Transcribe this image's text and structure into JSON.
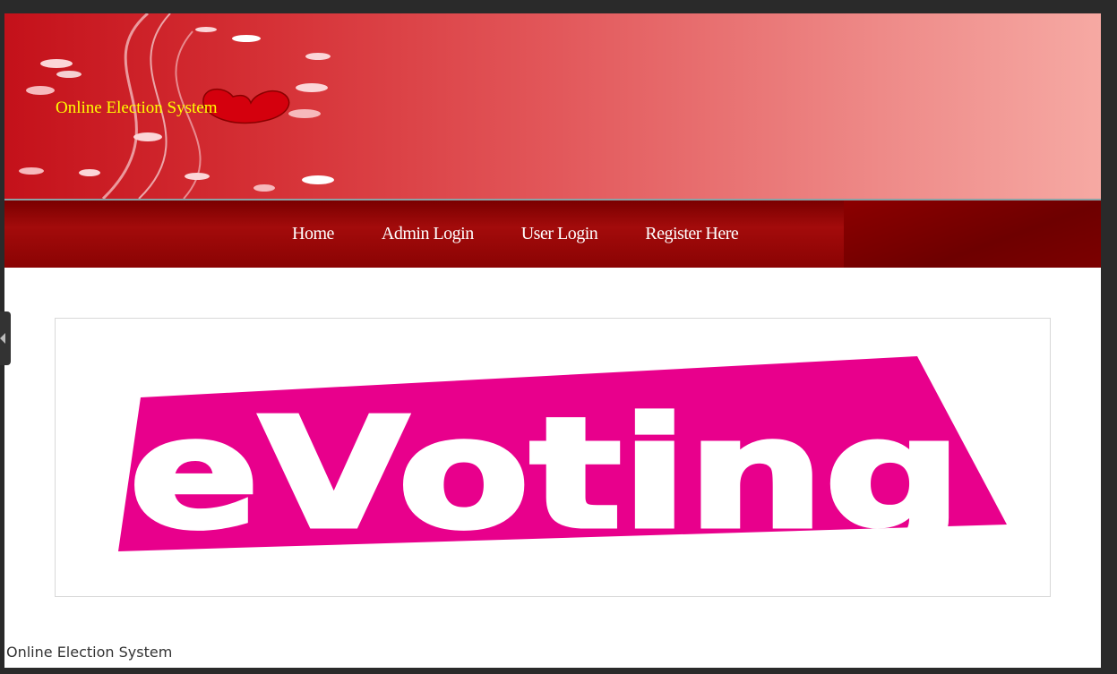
{
  "header": {
    "site_title": "Online Election System"
  },
  "nav": {
    "items": [
      {
        "label": "Home"
      },
      {
        "label": "Admin Login"
      },
      {
        "label": "User Login"
      },
      {
        "label": "Register Here"
      }
    ]
  },
  "banner": {
    "logo_text": "eVoting",
    "logo_color": "#e8008c"
  },
  "footer": {
    "text": "Online Election System"
  },
  "colors": {
    "title": "#ffff00",
    "nav_bg": "#8a0303",
    "header_start": "#c4111a",
    "header_end": "#f6a9a3"
  },
  "icons": [
    "heart-icon",
    "side-collapse-arrow-icon"
  ]
}
